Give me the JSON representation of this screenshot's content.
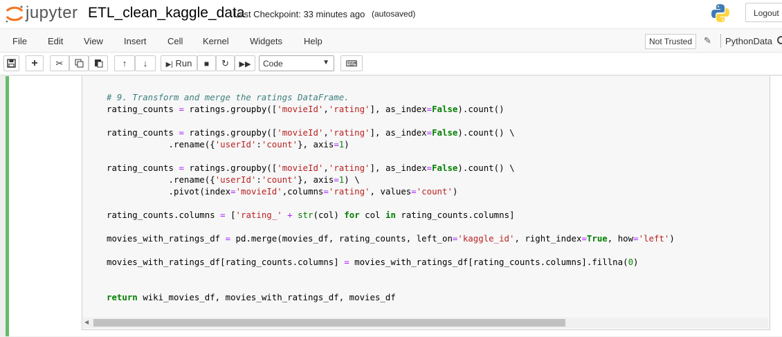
{
  "app": {
    "logo_text": "jupyter",
    "notebook_title": "ETL_clean_kaggle_data",
    "checkpoint": "Last Checkpoint: 33 minutes ago",
    "autosave": "(autosaved)",
    "logout_label": "Logout"
  },
  "menu": {
    "items": [
      "File",
      "Edit",
      "View",
      "Insert",
      "Cell",
      "Kernel",
      "Widgets",
      "Help"
    ],
    "trust_label": "Not Trusted",
    "kernel_name": "PythonData"
  },
  "toolbar": {
    "run_label": "Run",
    "cell_type": "Code"
  },
  "colors": {
    "cell_border": "#66bb6a",
    "string": "#ba2121",
    "comment": "#408080",
    "keyword": "#008000"
  },
  "icons": [
    "save-icon",
    "plus-icon",
    "cut-icon",
    "copy-icon",
    "paste-icon",
    "arrow-up-icon",
    "arrow-down-icon",
    "run-icon",
    "stop-icon",
    "restart-icon",
    "fast-forward-icon",
    "keyboard-icon",
    "pencil-icon",
    "kernel-status-icon"
  ],
  "code_lines": [
    "# 9. Transform and merge the ratings DataFrame.",
    "rating_counts = ratings.groupby(['movieId','rating'], as_index=False).count()",
    "",
    "rating_counts = ratings.groupby(['movieId','rating'], as_index=False).count() \\",
    "            .rename({'userId':'count'}, axis=1)",
    "",
    "rating_counts = ratings.groupby(['movieId','rating'], as_index=False).count() \\",
    "            .rename({'userId':'count'}, axis=1) \\",
    "            .pivot(index='movieId',columns='rating', values='count')",
    "",
    "rating_counts.columns = ['rating_' + str(col) for col in rating_counts.columns]",
    "",
    "movies_with_ratings_df = pd.merge(movies_df, rating_counts, left_on='kaggle_id', right_index=True, how='left')",
    "",
    "movies_with_ratings_df[rating_counts.columns] = movies_with_ratings_df[rating_counts.columns].fillna(0)",
    "",
    "",
    "return wiki_movies_df, movies_with_ratings_df, movies_df"
  ]
}
